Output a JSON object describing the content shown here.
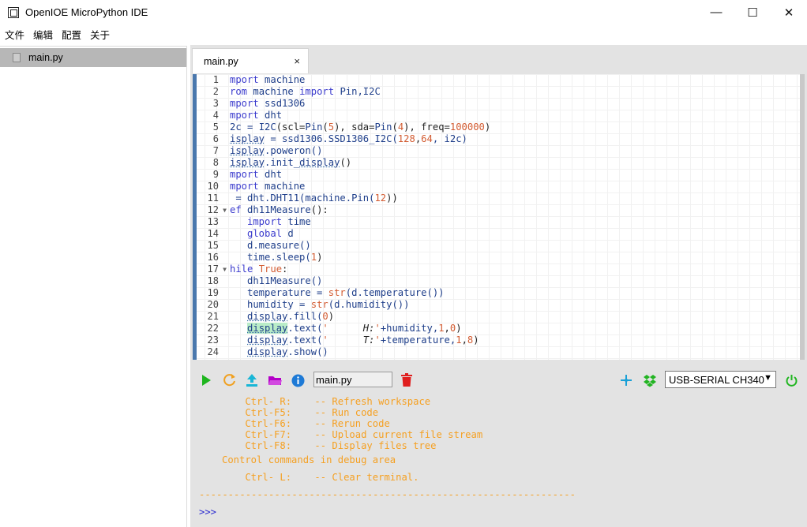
{
  "window": {
    "title": "OpenIOE MicroPython IDE",
    "controls": [
      "—",
      "☐",
      "✕"
    ]
  },
  "menu": [
    "文件",
    "编辑",
    "配置",
    "关于"
  ],
  "sidebar": {
    "items": [
      {
        "label": "main.py"
      }
    ]
  },
  "tab": {
    "label": "main.py",
    "close": "×"
  },
  "editor": {
    "line_numbers": [
      "1",
      "2",
      "3",
      "4",
      "5",
      "6",
      "7",
      "8",
      "9",
      "10",
      "11",
      "12",
      "13",
      "14",
      "15",
      "16",
      "17",
      "18",
      "19",
      "20",
      "21",
      "22",
      "23",
      "24"
    ],
    "fold_lines": [
      "12",
      "17"
    ],
    "lines": [
      [
        {
          "t": "mport ",
          "c": "kw"
        },
        {
          "t": "machine",
          "c": "id"
        }
      ],
      [
        {
          "t": "rom ",
          "c": "kw"
        },
        {
          "t": "machine ",
          "c": "id"
        },
        {
          "t": "import ",
          "c": "kw"
        },
        {
          "t": "Pin,I2C",
          "c": "id"
        }
      ],
      [
        {
          "t": "mport ",
          "c": "kw"
        },
        {
          "t": "ssd1306",
          "c": "id"
        }
      ],
      [
        {
          "t": "mport ",
          "c": "kw"
        },
        {
          "t": "dht",
          "c": "id"
        }
      ],
      [
        {
          "t": "2c = ",
          "c": "id"
        },
        {
          "t": "I2C",
          "c": "id"
        },
        {
          "t": "(scl=",
          "c": ""
        },
        {
          "t": "Pin",
          "c": "id"
        },
        {
          "t": "(",
          "c": ""
        },
        {
          "t": "5",
          "c": "num"
        },
        {
          "t": "), sda=",
          "c": ""
        },
        {
          "t": "Pin",
          "c": "id"
        },
        {
          "t": "(",
          "c": ""
        },
        {
          "t": "4",
          "c": "num"
        },
        {
          "t": "), freq=",
          "c": ""
        },
        {
          "t": "100000",
          "c": "num"
        },
        {
          "t": ")",
          "c": ""
        }
      ],
      [
        {
          "t": "isplay",
          "c": "id und"
        },
        {
          "t": " = ssd1306.SSD1306_I2C(",
          "c": "id"
        },
        {
          "t": "128",
          "c": "num"
        },
        {
          "t": ",",
          "c": ""
        },
        {
          "t": "64",
          "c": "num"
        },
        {
          "t": ", i2c)",
          "c": "id"
        }
      ],
      [
        {
          "t": "isplay",
          "c": "id und"
        },
        {
          "t": ".poweron()",
          "c": "id"
        }
      ],
      [
        {
          "t": "isplay",
          "c": "id und"
        },
        {
          "t": ".init_",
          "c": "id"
        },
        {
          "t": "display",
          "c": "id und"
        },
        {
          "t": "()",
          "c": ""
        }
      ],
      [
        {
          "t": "mport ",
          "c": "kw"
        },
        {
          "t": "dht",
          "c": "id"
        }
      ],
      [
        {
          "t": "mport ",
          "c": "kw"
        },
        {
          "t": "machine",
          "c": "id"
        }
      ],
      [
        {
          "t": " = dht.DHT11(machine.Pin(",
          "c": "id"
        },
        {
          "t": "12",
          "c": "num"
        },
        {
          "t": "))",
          "c": ""
        }
      ],
      [
        {
          "t": "ef ",
          "c": "kw"
        },
        {
          "t": "dh11Measure",
          "c": "id"
        },
        {
          "t": "():",
          "c": ""
        }
      ],
      [
        {
          "t": "   import ",
          "c": "kw"
        },
        {
          "t": "time",
          "c": "id"
        }
      ],
      [
        {
          "t": "   global ",
          "c": "kw"
        },
        {
          "t": "d",
          "c": "id"
        }
      ],
      [
        {
          "t": "   d.measure()",
          "c": "id"
        }
      ],
      [
        {
          "t": "   time.sleep(",
          "c": "id"
        },
        {
          "t": "1",
          "c": "num"
        },
        {
          "t": ")",
          "c": ""
        }
      ],
      [
        {
          "t": "hile ",
          "c": "kw"
        },
        {
          "t": "True",
          "c": "num"
        },
        {
          "t": ":",
          "c": ""
        }
      ],
      [
        {
          "t": "   dh11Measure()",
          "c": "id"
        }
      ],
      [
        {
          "t": "   temperature = ",
          "c": "id"
        },
        {
          "t": "str",
          "c": "num"
        },
        {
          "t": "(d.temperature())",
          "c": "id"
        }
      ],
      [
        {
          "t": "   humidity = ",
          "c": "id"
        },
        {
          "t": "str",
          "c": "num"
        },
        {
          "t": "(d.humidity())",
          "c": "id"
        }
      ],
      [
        {
          "t": "   ",
          "c": ""
        },
        {
          "t": "display",
          "c": "id und"
        },
        {
          "t": ".fill(",
          "c": "id"
        },
        {
          "t": "0",
          "c": "num"
        },
        {
          "t": ")",
          "c": ""
        }
      ],
      [
        {
          "t": "   ",
          "c": ""
        },
        {
          "t": "display",
          "c": "id und hl"
        },
        {
          "t": ".text(",
          "c": "id"
        },
        {
          "t": "'      ",
          "c": "num"
        },
        {
          "t": "H:",
          "c": "it"
        },
        {
          "t": "'",
          "c": "num"
        },
        {
          "t": "+humidity,",
          "c": "id"
        },
        {
          "t": "1",
          "c": "num"
        },
        {
          "t": ",",
          "c": ""
        },
        {
          "t": "0",
          "c": "num"
        },
        {
          "t": ")",
          "c": ""
        }
      ],
      [
        {
          "t": "   ",
          "c": ""
        },
        {
          "t": "display",
          "c": "id und"
        },
        {
          "t": ".text(",
          "c": "id"
        },
        {
          "t": "'      ",
          "c": "num"
        },
        {
          "t": "T:",
          "c": "it"
        },
        {
          "t": "'",
          "c": "num"
        },
        {
          "t": "+temperature,",
          "c": "id"
        },
        {
          "t": "1",
          "c": "num"
        },
        {
          "t": ",",
          "c": ""
        },
        {
          "t": "8",
          "c": "num"
        },
        {
          "t": ")",
          "c": ""
        }
      ],
      [
        {
          "t": "   ",
          "c": ""
        },
        {
          "t": "display",
          "c": "id und"
        },
        {
          "t": ".show()",
          "c": "id"
        }
      ]
    ]
  },
  "toolbar": {
    "filename_value": "main.py",
    "port_selected": "USB-SERIAL CH340",
    "dropdown_arrow": "▼",
    "icons": [
      "run-icon",
      "refresh-icon",
      "upload-icon",
      "folder-icon",
      "info-icon",
      "delete-icon",
      "pin-icon",
      "dropbox-icon",
      "power-icon"
    ],
    "colors": {
      "run": "#1eb51e",
      "refresh": "#f0a020",
      "upload": "#19b6d6",
      "folder": "#b400c8",
      "info": "#1e7ad6",
      "delete": "#e01e1e",
      "pin": "#19a0d6",
      "dropbox": "#22b422",
      "power": "#1eb51e"
    }
  },
  "terminal": {
    "lines": [
      "    Ctrl- R:    -- Refresh workspace",
      "    Ctrl-F5:    -- Run code",
      "    Ctrl-F6:    -- Rerun code",
      "    Ctrl-F7:    -- Upload current file stream",
      "    Ctrl-F8:    -- Display files tree",
      "Control commands in debug area",
      "    Ctrl- L:    -- Clear terminal.",
      "-----------------------------------------------------------------",
      ">>>"
    ],
    "colors": {
      "text": "#f5a022",
      "prompt": "#2a2ad0"
    }
  }
}
